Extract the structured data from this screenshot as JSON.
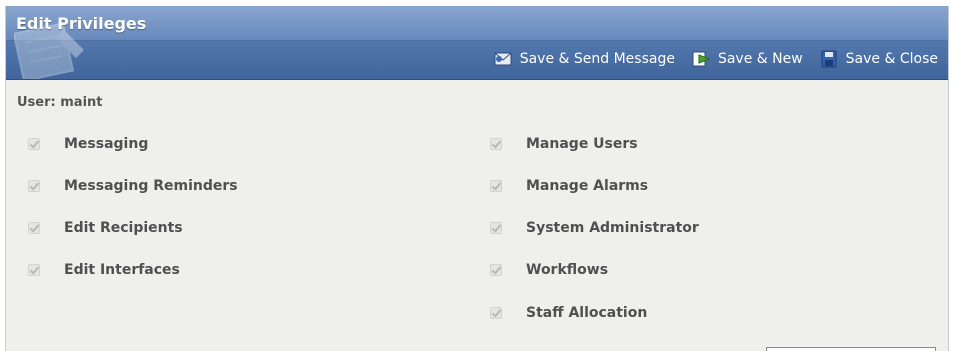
{
  "dialog": {
    "title": "Edit Privileges"
  },
  "toolbar": {
    "buttons": [
      {
        "label": "Save & Send Message",
        "icon": "send-message-icon"
      },
      {
        "label": "Save & New",
        "icon": "save-new-icon"
      },
      {
        "label": "Save & Close",
        "icon": "save-disk-icon"
      }
    ]
  },
  "user": {
    "label": "User: maint"
  },
  "privileges": {
    "left": [
      {
        "label": "Messaging",
        "checked": true
      },
      {
        "label": "Messaging Reminders",
        "checked": true
      },
      {
        "label": "Edit Recipients",
        "checked": true
      },
      {
        "label": "Edit Interfaces",
        "checked": true
      }
    ],
    "right": [
      {
        "label": "Manage Users",
        "checked": true
      },
      {
        "label": "Manage Alarms",
        "checked": true
      },
      {
        "label": "System Administrator",
        "checked": true
      },
      {
        "label": "Workflows",
        "checked": true
      },
      {
        "label": "Staff Allocation",
        "checked": true
      }
    ]
  },
  "colors": {
    "header_blue": "#5479ad",
    "background": "#efefeb",
    "label_text": "#505050"
  }
}
